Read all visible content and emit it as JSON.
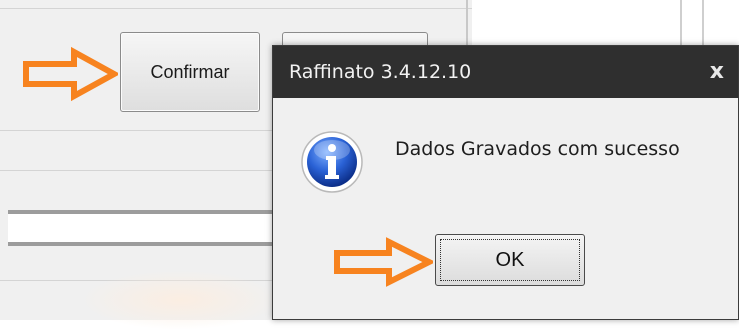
{
  "background": {
    "confirm_button_label": "Confirmar"
  },
  "dialog": {
    "title": "Raffinato 3.4.12.10",
    "close_glyph": "x",
    "message": "Dados Gravados com sucesso",
    "icon": "info-icon",
    "ok_label": "OK"
  },
  "annotations": {
    "arrow_color": "#f7831f",
    "arrow_icon": "right-arrow-outline-icon"
  },
  "colors": {
    "titlebar": "#2f2f2f",
    "dialog_bg": "#f0f0f0",
    "info_icon_blue": "#1d54c4"
  }
}
